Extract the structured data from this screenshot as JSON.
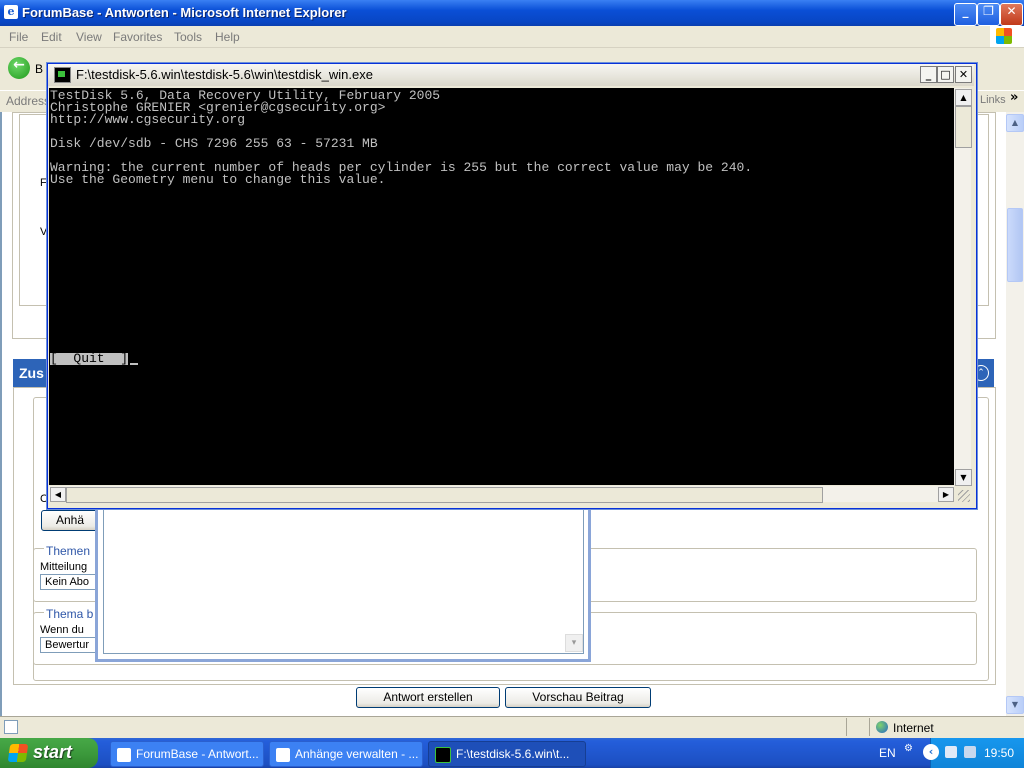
{
  "browser": {
    "title": "ForumBase - Antworten - Microsoft Internet Explorer",
    "menu": [
      "File",
      "Edit",
      "View",
      "Favorites",
      "Tools",
      "Help"
    ],
    "back_label": "B",
    "address_label": "Address",
    "links_label": "Links",
    "links_chevron": "»",
    "status_zone": "Internet"
  },
  "page": {
    "section_title": "Zus",
    "upload_button": "Anhä",
    "topic_legend": "Themen",
    "notify_label": "Mitteilung",
    "notify_select": "Kein Abo",
    "rate_legend": "Thema b",
    "rate_text": "Wenn du",
    "rate_select": "Bewertur",
    "partial_left_letters": [
      "V",
      "F",
      "C"
    ],
    "submit_button": "Antwort erstellen",
    "preview_button": "Vorschau Beitrag"
  },
  "console": {
    "title": "F:\\testdisk-5.6.win\\testdisk-5.6\\win\\testdisk_win.exe",
    "lines": [
      "TestDisk 5.6, Data Recovery Utility, February 2005",
      "Christophe GRENIER <grenier@cgsecurity.org>",
      "http://www.cgsecurity.org",
      "",
      "Disk /dev/sdb - CHS 7296 255 63 - 57231 MB",
      "",
      "Warning: the current number of heads per cylinder is 255 but the correct value may be 240.",
      "Use the Geometry menu to change this value."
    ],
    "quit_option": "[  Quit  ]"
  },
  "taskbar": {
    "start_label": "start",
    "tasks": [
      {
        "label": "ForumBase - Antwort..."
      },
      {
        "label": "Anhänge verwalten - ..."
      },
      {
        "label": "F:\\testdisk-5.6.win\\t..."
      }
    ],
    "language": "EN",
    "clock": "19:50"
  }
}
